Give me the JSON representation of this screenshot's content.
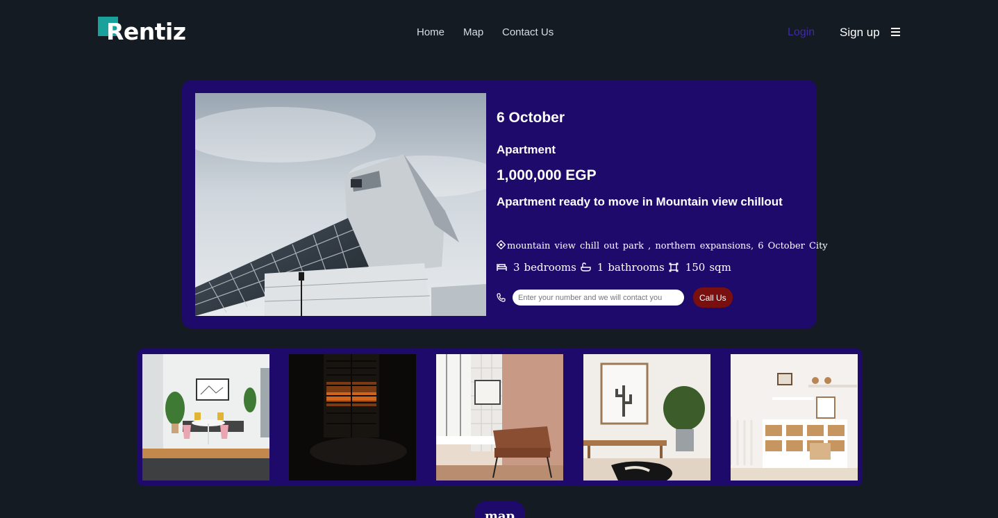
{
  "header": {
    "logo_text": "Rentiz",
    "nav": {
      "home": "Home",
      "map": "Map",
      "contact": "Contact Us"
    },
    "login": "Login",
    "signup": "Sign up",
    "menu_icon": "hamburger-icon"
  },
  "listing": {
    "city": "6 October",
    "type": "Apartment",
    "price": "1,000,000 EGP",
    "title": "Apartment ready to move in Mountain view chillout",
    "address": "mountain view chill out park , northern expansions, 6 October City",
    "bedrooms": "3",
    "bedrooms_label": "bedrooms",
    "bathrooms": "1",
    "bathrooms_label": "bathrooms",
    "area": "150",
    "area_label": "sqm",
    "phone_placeholder": "Enter your number and we will contact you",
    "call_button": "Call Us"
  },
  "gallery": {
    "images": [
      "living-room",
      "dark-window-room",
      "armchair-room",
      "cactus-print-room",
      "nursery-shelves"
    ]
  },
  "map_button": "map",
  "colors": {
    "background": "#141b22",
    "card": "#1d0a6b",
    "logo_accent": "#1aa19b",
    "login": "#3f2aa6",
    "call_button": "#7a0f0f"
  }
}
